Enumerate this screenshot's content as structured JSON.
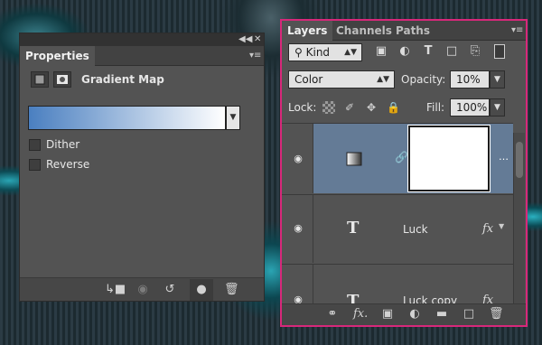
{
  "properties": {
    "tab_label": "Properties",
    "adjustment_title": "Gradient Map",
    "gradient": {
      "start_color": "#4a7fc0",
      "end_color": "#ffffff"
    },
    "options": [
      {
        "label": "Dither",
        "checked": false
      },
      {
        "label": "Reverse",
        "checked": false
      }
    ],
    "footer_icons": [
      "clip-to-layer-icon",
      "view-previous-state-icon",
      "reset-icon",
      "visibility-icon",
      "delete-icon"
    ]
  },
  "layers": {
    "tabs": [
      {
        "label": "Layers",
        "active": true
      },
      {
        "label": "Channels",
        "active": false
      },
      {
        "label": "Paths",
        "active": false
      }
    ],
    "filter_label": "Kind",
    "blend_mode": "Color",
    "opacity_label": "Opacity:",
    "opacity_value": "10%",
    "lock_label": "Lock:",
    "fill_label": "Fill:",
    "fill_value": "100%",
    "rows": [
      {
        "name": "",
        "type": "gradient-map-adjustment",
        "selected": true,
        "visible": true
      },
      {
        "name": "Luck",
        "type": "text",
        "selected": false,
        "visible": true,
        "fx": "fx"
      },
      {
        "name": "Luck copy",
        "type": "text",
        "selected": false,
        "visible": true,
        "fx": "fx"
      }
    ],
    "footer_icons": [
      "link-icon",
      "fx-icon",
      "mask-icon",
      "adjustment-icon",
      "folder-icon",
      "new-layer-icon",
      "trash-icon"
    ]
  },
  "colors": {
    "panel": "#535353",
    "selected_row": "#647b96",
    "highlight_border": "#d8287a"
  }
}
